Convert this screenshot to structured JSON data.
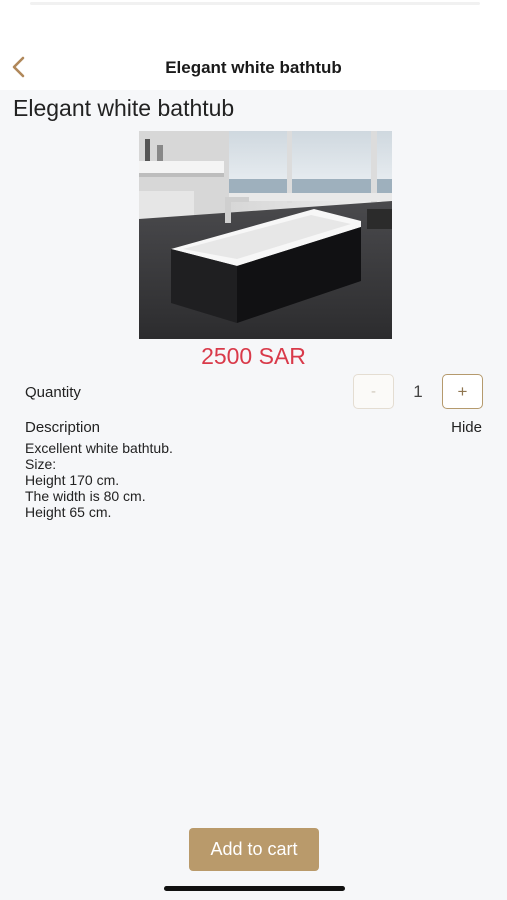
{
  "header": {
    "title": "Elegant white bathtub",
    "back_icon": "chevron-left-icon",
    "accent_color": "#b0885a"
  },
  "product": {
    "title": "Elegant white bathtub",
    "image_icon": "bathtub-photo",
    "price": "2500 SAR",
    "price_color": "#d93a4a"
  },
  "quantity": {
    "label": "Quantity",
    "decrement_label": "-",
    "value": "1",
    "increment_label": "+"
  },
  "description": {
    "label": "Description",
    "toggle_label": "Hide",
    "lines": [
      "Excellent white bathtub.",
      "Size:",
      "Height 170 cm.",
      "The width is 80 cm.",
      "Height 65 cm."
    ]
  },
  "cart": {
    "add_label": "Add to cart",
    "button_color": "#b99a6b"
  }
}
